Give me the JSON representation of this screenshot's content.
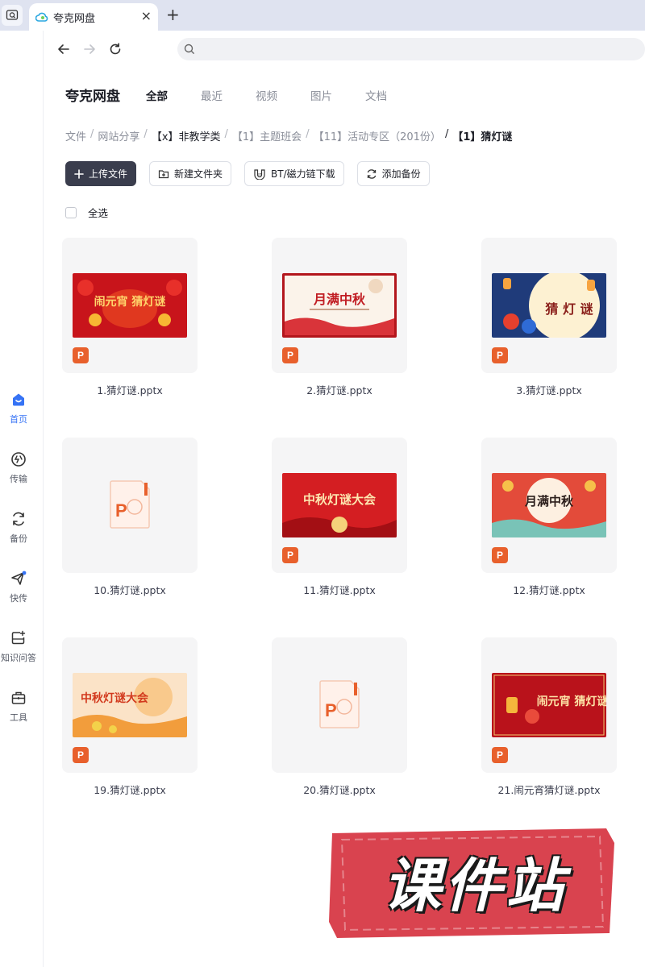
{
  "browser": {
    "tab_title": "夸克网盘",
    "tab_close": "×",
    "new_tab": "+",
    "address_placeholder": ""
  },
  "rail": {
    "items": [
      {
        "label": "首页",
        "icon": "home-icon",
        "active": true
      },
      {
        "label": "传输",
        "icon": "transfer-icon"
      },
      {
        "label": "备份",
        "icon": "backup-icon"
      },
      {
        "label": "快传",
        "icon": "quick-send-icon"
      },
      {
        "label": "知识问答",
        "icon": "qa-icon"
      },
      {
        "label": "工具",
        "icon": "toolbox-icon"
      }
    ]
  },
  "header": {
    "brand": "夸克网盘",
    "tabs": [
      "全部",
      "最近",
      "视频",
      "图片",
      "文档"
    ],
    "active_tab": "全部"
  },
  "breadcrumb": [
    "文件",
    "网站分享",
    "【x】非教学类",
    "【1】主题班会",
    "【11】活动专区（201份）",
    "【1】猜灯谜"
  ],
  "actions": {
    "upload": "上传文件",
    "new_folder": "新建文件夹",
    "bt": "BT/磁力链下载",
    "backup": "添加备份"
  },
  "select_all": "全选",
  "files": [
    {
      "name": "1.猜灯谜.pptx",
      "thumb_title": "闹元宵 猜灯谜",
      "type_badge": "P"
    },
    {
      "name": "2.猜灯谜.pptx",
      "thumb_title": "月满中秋",
      "type_badge": "P"
    },
    {
      "name": "3.猜灯谜.pptx",
      "thumb_title": "猜 灯 谜",
      "type_badge": "P"
    },
    {
      "name": "10.猜灯谜.pptx",
      "thumb_title": "",
      "type_badge": "P"
    },
    {
      "name": "11.猜灯谜.pptx",
      "thumb_title": "中秋灯谜大会",
      "type_badge": "P"
    },
    {
      "name": "12.猜灯谜.pptx",
      "thumb_title": "月满中秋",
      "type_badge": "P"
    },
    {
      "name": "19.猜灯谜.pptx",
      "thumb_title": "中秋灯谜大会",
      "type_badge": "P"
    },
    {
      "name": "20.猜灯谜.pptx",
      "thumb_title": "",
      "type_badge": "P"
    },
    {
      "name": "21.闹元宵猜灯谜.pptx",
      "thumb_title": "闹元宵 猜灯谜",
      "type_badge": "P"
    }
  ],
  "watermark": "课件站",
  "colors": {
    "accent": "#3673f5",
    "ppt": "#e8602c",
    "primary_button": "#3a3d4d",
    "watermark_red": "#d9434f"
  }
}
